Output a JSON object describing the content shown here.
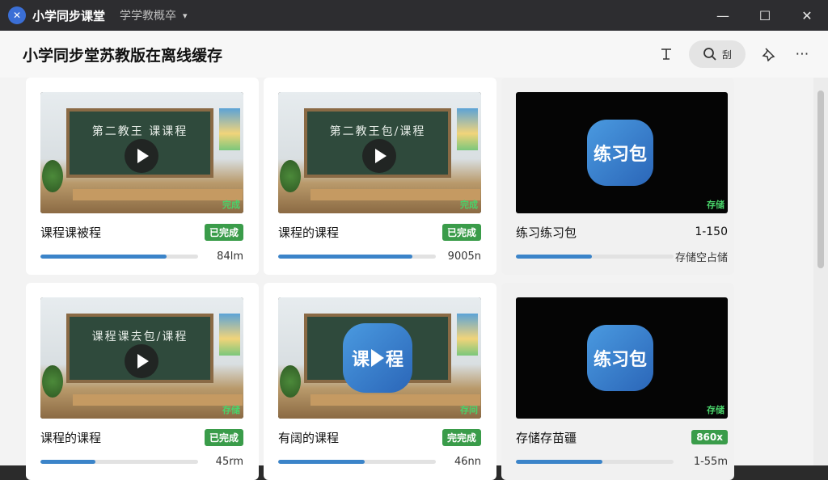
{
  "titlebar": {
    "app_title": "小学同步课堂",
    "subject_selector": "学学教概卒",
    "controls": {
      "minimize": "—",
      "maximize": "☐",
      "close": "✕"
    }
  },
  "header": {
    "page_title": "小学同步堂苏教版在离线缓存",
    "search_label": "刮",
    "icons": [
      "text-format-icon",
      "search-icon",
      "pin-icon",
      "more-icon"
    ]
  },
  "cards": [
    {
      "type": "video",
      "board_text": "第二教王 课课程",
      "thumb_status": "完成",
      "title": "课程课被程",
      "badge": "已完成",
      "progress": 0.8,
      "size": "84lm"
    },
    {
      "type": "video",
      "board_text": "第二教王包/课程",
      "thumb_status": "完成",
      "title": "课程的课程",
      "badge": "已完成",
      "progress": 0.85,
      "size": "9005n"
    },
    {
      "type": "practice",
      "badge_text": "练习包",
      "thumb_status": "存储",
      "title": "练习练习包",
      "range": "1-150",
      "progress": 0.48,
      "size": "存储空占储"
    },
    {
      "type": "video",
      "board_text": "课程课去包/课程",
      "thumb_status": "存储",
      "title": "课程的课程",
      "badge": "已完成",
      "progress": 0.35,
      "size": "45rm"
    },
    {
      "type": "course",
      "board_text": "课",
      "badge_text_left": "课",
      "badge_text_right": "程",
      "thumb_status": "存间",
      "title": "有阔的课程",
      "badge": "完完成",
      "progress": 0.55,
      "size": "46nn"
    },
    {
      "type": "practice",
      "badge_text": "练习包",
      "thumb_status": "存储",
      "title": "存储存苗疆",
      "badge": "860x",
      "range": "1-55m",
      "progress": 0.55,
      "size": ""
    }
  ]
}
